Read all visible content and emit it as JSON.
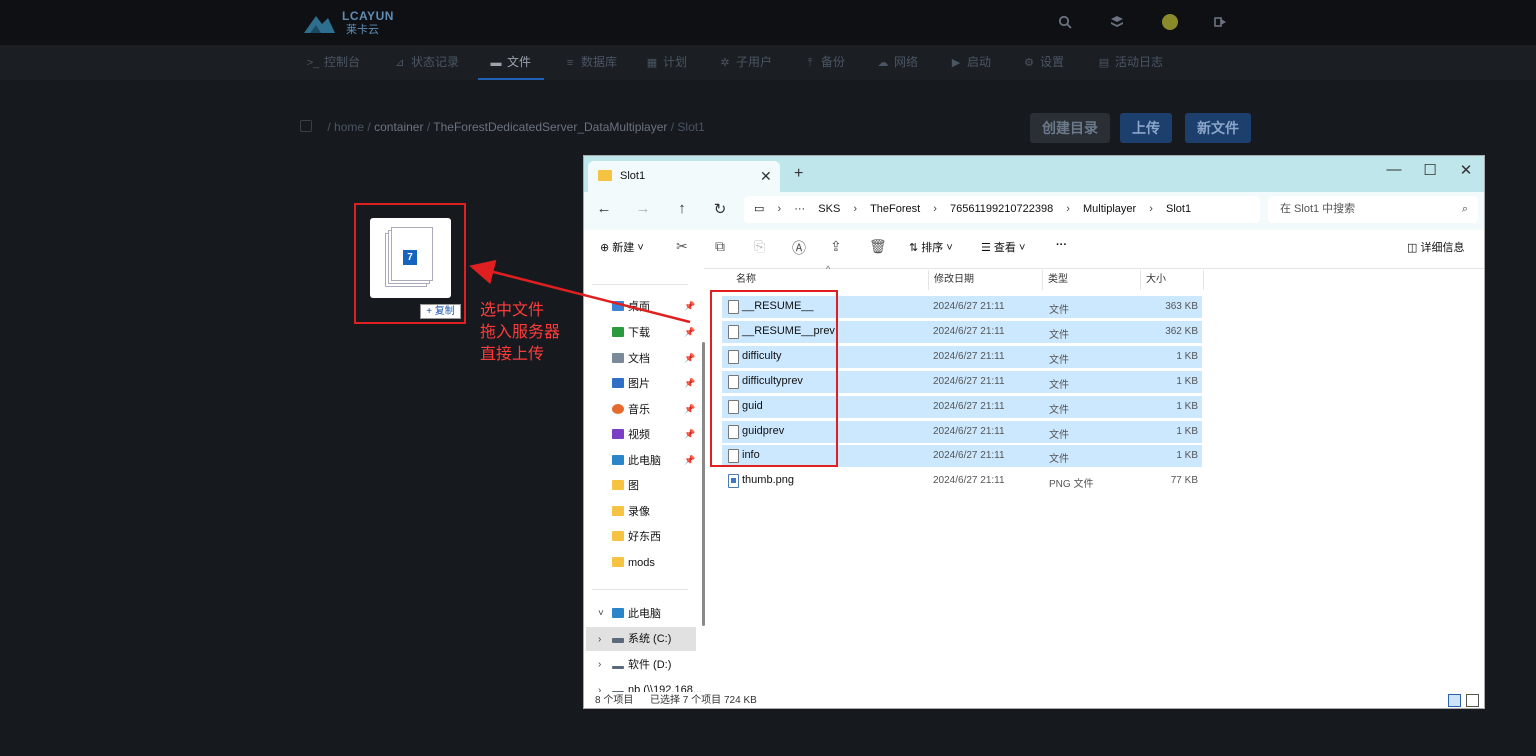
{
  "topbar": {
    "logo_text": "LCAYUN",
    "logo_sub": "莱卡云",
    "icons": [
      "search-icon",
      "layers-icon",
      "user-avatar",
      "logout-icon"
    ]
  },
  "nav": {
    "items": [
      {
        "icon": ">_",
        "label": "控制台"
      },
      {
        "icon": "📈",
        "label": "状态记录"
      },
      {
        "icon": "▬",
        "label": "文件",
        "active": true
      },
      {
        "icon": "🗄",
        "label": "数据库"
      },
      {
        "icon": "▦",
        "label": "计划"
      },
      {
        "icon": "👥",
        "label": "子用户"
      },
      {
        "icon": "⤒",
        "label": "备份"
      },
      {
        "icon": "☁",
        "label": "网络"
      },
      {
        "icon": "▶",
        "label": "启动"
      },
      {
        "icon": "⚙",
        "label": "设置"
      },
      {
        "icon": "▤",
        "label": "活动日志"
      }
    ]
  },
  "breadcrumb": {
    "root_sep": "/",
    "parts": [
      "home",
      "container",
      "TheForestDedicatedServer_DataMultiplayer",
      "Slot1"
    ]
  },
  "actions": {
    "mkdir": "创建目录",
    "upload": "上传",
    "newfile": "新文件"
  },
  "drag": {
    "count": "7",
    "copy_label": "+ 复制"
  },
  "annotation": {
    "line1": "选中文件",
    "line2": "拖入服务器",
    "line3": "直接上传"
  },
  "explorer": {
    "tab_title": "Slot1",
    "address": [
      "SKS",
      "TheForest",
      "76561199210722398",
      "Multiplayer",
      "Slot1"
    ],
    "search_placeholder": "在 Slot1 中搜索",
    "toolbar": {
      "new": "新建",
      "sort": "排序",
      "view": "查看",
      "more": "···",
      "details": "详细信息"
    },
    "columns": {
      "name": "名称",
      "date": "修改日期",
      "type": "类型",
      "size": "大小"
    },
    "sidebar": [
      {
        "label": "桌面",
        "pinned": true,
        "color": "#3b83d6"
      },
      {
        "label": "下载",
        "pinned": true,
        "color": "#2b9a3e"
      },
      {
        "label": "文档",
        "pinned": true,
        "color": "#7a8a99"
      },
      {
        "label": "图片",
        "pinned": true,
        "color": "#2e6fc7"
      },
      {
        "label": "音乐",
        "pinned": true,
        "color": "#e56a2e"
      },
      {
        "label": "视频",
        "pinned": true,
        "color": "#7b3fc4"
      },
      {
        "label": "此电脑",
        "pinned": true,
        "color": "#2a86c9"
      },
      {
        "label": "图",
        "pinned": false,
        "color": "#f5c242"
      },
      {
        "label": "录像",
        "pinned": false,
        "color": "#f5c242"
      },
      {
        "label": "好东西",
        "pinned": false,
        "color": "#f5c242"
      },
      {
        "label": "mods",
        "pinned": false,
        "color": "#f5c242"
      }
    ],
    "tree": [
      {
        "label": "此电脑",
        "expanded": true
      },
      {
        "label": "系统 (C:)",
        "selected": true
      },
      {
        "label": "软件 (D:)"
      },
      {
        "label": "nb (\\\\192.168..."
      }
    ],
    "files": [
      {
        "name": "__RESUME__",
        "date": "2024/6/27 21:11",
        "type": "文件",
        "size": "363 KB",
        "selected": true
      },
      {
        "name": "__RESUME__prev",
        "date": "2024/6/27 21:11",
        "type": "文件",
        "size": "362 KB",
        "selected": true
      },
      {
        "name": "difficulty",
        "date": "2024/6/27 21:11",
        "type": "文件",
        "size": "1 KB",
        "selected": true
      },
      {
        "name": "difficultyprev",
        "date": "2024/6/27 21:11",
        "type": "文件",
        "size": "1 KB",
        "selected": true
      },
      {
        "name": "guid",
        "date": "2024/6/27 21:11",
        "type": "文件",
        "size": "1 KB",
        "selected": true
      },
      {
        "name": "guidprev",
        "date": "2024/6/27 21:11",
        "type": "文件",
        "size": "1 KB",
        "selected": true
      },
      {
        "name": "info",
        "date": "2024/6/27 21:11",
        "type": "文件",
        "size": "1 KB",
        "selected": true
      },
      {
        "name": "thumb.png",
        "date": "2024/6/27 21:11",
        "type": "PNG 文件",
        "size": "77 KB",
        "selected": false
      }
    ],
    "status": {
      "count": "8 个项目",
      "selected": "已选择 7 个项目",
      "size": "724 KB"
    }
  }
}
